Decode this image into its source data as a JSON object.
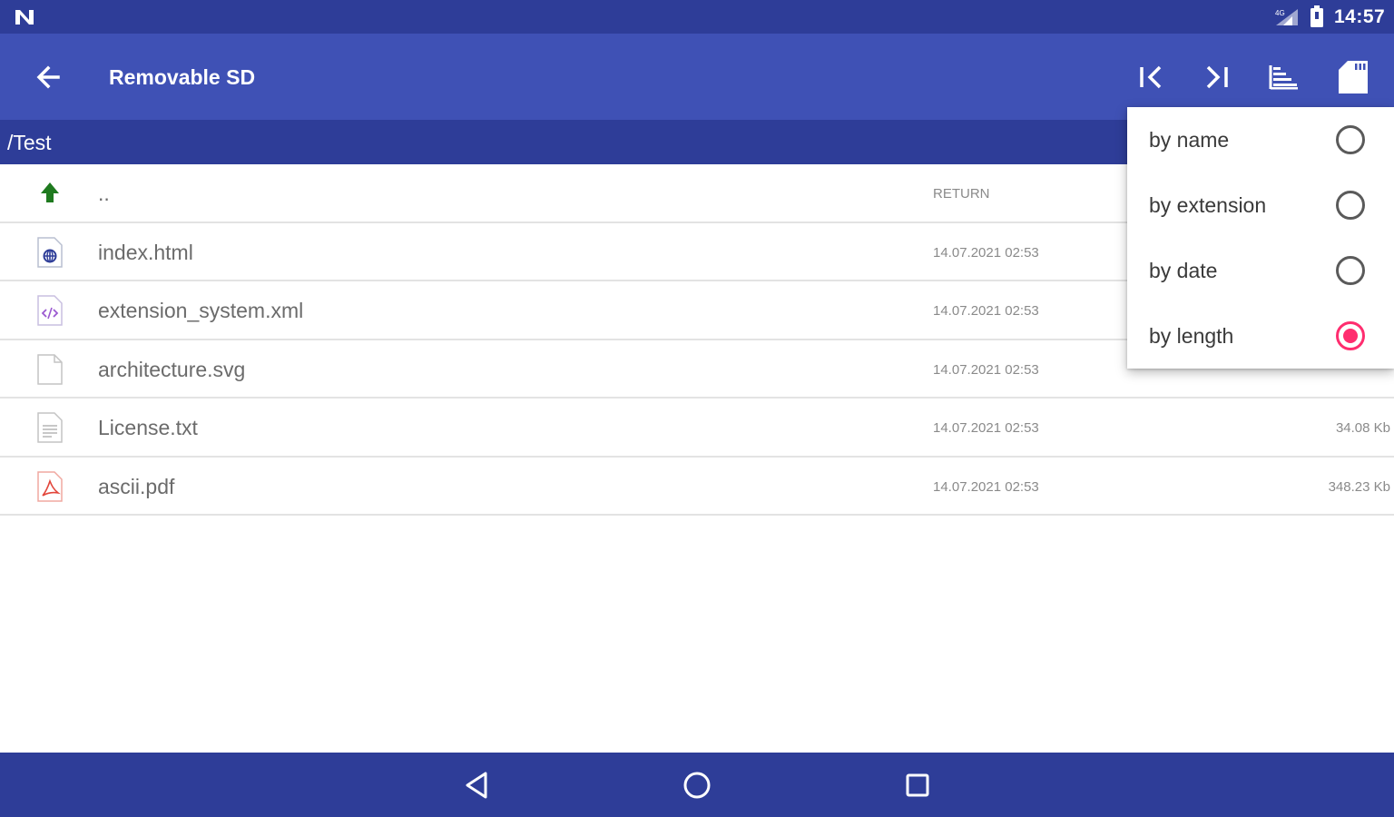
{
  "status_bar": {
    "time": "14:57",
    "icons": [
      "n-notification-icon",
      "signal-icon",
      "battery-icon"
    ]
  },
  "app_bar": {
    "title": "Removable SD",
    "back_icon": "arrow-back-icon",
    "actions": [
      "skip-first-icon",
      "skip-last-icon",
      "sort-icon",
      "sd-card-icon"
    ]
  },
  "path_bar": {
    "path": "/Test"
  },
  "files": [
    {
      "name": "..",
      "date": "RETURN",
      "size": "",
      "icon": "folder-up-icon"
    },
    {
      "name": "index.html",
      "date": "14.07.2021 02:53",
      "size": "",
      "icon": "html-file-icon"
    },
    {
      "name": "extension_system.xml",
      "date": "14.07.2021 02:53",
      "size": "",
      "icon": "xml-file-icon"
    },
    {
      "name": "architecture.svg",
      "date": "14.07.2021 02:53",
      "size": "",
      "icon": "blank-file-icon"
    },
    {
      "name": "License.txt",
      "date": "14.07.2021 02:53",
      "size": "34.08 Kb",
      "icon": "text-file-icon"
    },
    {
      "name": "ascii.pdf",
      "date": "14.07.2021 02:53",
      "size": "348.23 Kb",
      "icon": "pdf-file-icon"
    }
  ],
  "sort_menu": {
    "options": [
      {
        "label": "by name",
        "checked": false
      },
      {
        "label": "by extension",
        "checked": false
      },
      {
        "label": "by date",
        "checked": false
      },
      {
        "label": "by length",
        "checked": true
      }
    ]
  },
  "nav_bar": {
    "buttons": [
      "back-triangle-icon",
      "home-circle-icon",
      "recents-square-icon"
    ]
  },
  "colors": {
    "status_bar": "#2e3d98",
    "app_bar": "#3f51b5",
    "path_bar": "#2e3d98",
    "radio_accent": "#ff2d6f",
    "nav_bar": "#2e3d98"
  }
}
